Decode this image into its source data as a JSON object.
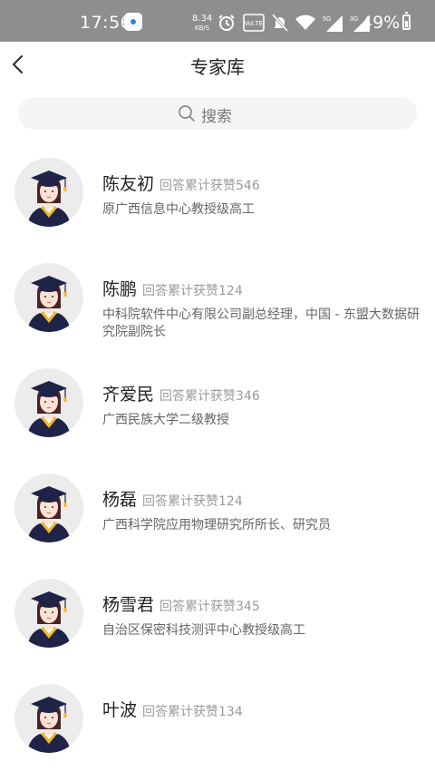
{
  "status_bar": {
    "time": "17:56",
    "net_speed": "8.34",
    "net_speed_unit": "KB/S",
    "battery_percent": "49%",
    "volte_label": "VoLTE",
    "signal_5g": "5G",
    "signal_3g": "3G"
  },
  "header": {
    "title": "专家库",
    "back_icon": "chevron-left-icon"
  },
  "search": {
    "placeholder": "搜索",
    "icon": "search-icon"
  },
  "experts": [
    {
      "name": "陈友初",
      "stat": "回答累计获赞546",
      "title": "原广西信息中心教授级高工"
    },
    {
      "name": "陈鹏",
      "stat": "回答累计获赞124",
      "title": "中科院软件中心有限公司副总经理，中国 - 东盟大数据研究院副院长"
    },
    {
      "name": "齐爱民",
      "stat": "回答累计获赞346",
      "title": "广西民族大学二级教授"
    },
    {
      "name": "杨磊",
      "stat": "回答累计获赞124",
      "title": "广西科学院应用物理研究所所长、研究员"
    },
    {
      "name": "杨雪君",
      "stat": "回答累计获赞345",
      "title": "自治区保密科技测评中心教授级高工"
    },
    {
      "name": "叶波",
      "stat": "回答累计获赞134",
      "title": ""
    }
  ],
  "colors": {
    "status_bar_bg": "#8e8e8e",
    "search_bg": "#f5f5f5",
    "cap": "#1f2347",
    "tassel": "#f2b62b",
    "face": "#fde2d3",
    "hair": "#4a2326"
  }
}
